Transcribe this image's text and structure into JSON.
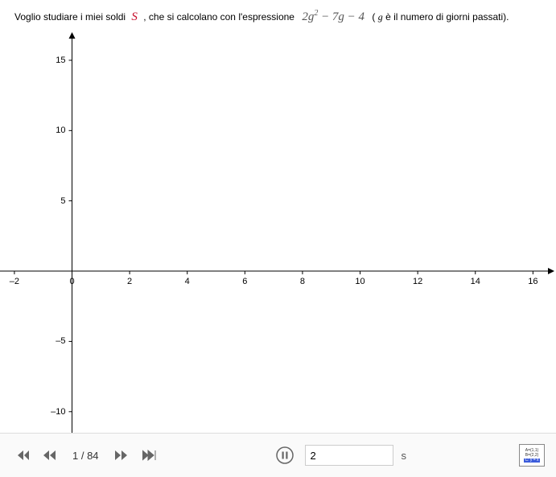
{
  "problem": {
    "prefix": "Voglio studiare i miei soldi ",
    "symbol": "S",
    "mid1": ", che si calcolano con l'espressione ",
    "expression_html": "2g<sup>2</sup> − 7g − 4",
    "mid2": " ( ",
    "var": "g",
    "suffix": " è il numero di giorni passati)."
  },
  "chart_data": {
    "type": "line",
    "title": "",
    "xlabel": "",
    "ylabel": "",
    "xlim": [
      -2.5,
      16.8
    ],
    "ylim": [
      -11.5,
      17
    ],
    "x_ticks": [
      -2,
      0,
      2,
      4,
      6,
      8,
      10,
      12,
      14,
      16
    ],
    "y_ticks": [
      -10,
      -5,
      5,
      10,
      15
    ],
    "series": [],
    "grid": false
  },
  "playback": {
    "current_frame": 1,
    "total_frames": 84,
    "separator": " / ",
    "speed_value": "2",
    "speed_unit": "s"
  },
  "icons": {
    "first": "⏮",
    "prev": "◀◀",
    "next": "▶▶",
    "last": "⏭",
    "pause": "⏸"
  }
}
